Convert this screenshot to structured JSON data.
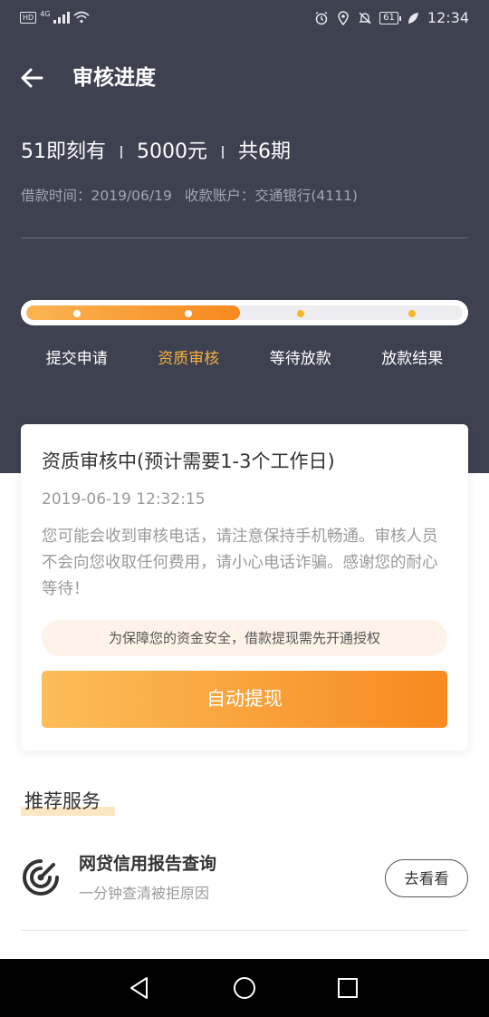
{
  "status_bar": {
    "network": "HD",
    "signal_type": "4G",
    "battery": "61",
    "time": "12:34",
    "icons": [
      "alarm-icon",
      "location-icon",
      "mute-icon",
      "battery-icon",
      "leaf-icon"
    ]
  },
  "header": {
    "title": "审核进度",
    "back_icon": "arrow-left-icon"
  },
  "loan": {
    "product": "51即刻有",
    "amount": "5000元",
    "periods": "共6期",
    "borrow_time": "借款时间：2019/06/19",
    "account": "收款账户：交通银行(4111)"
  },
  "progress": {
    "current_step_index": 1,
    "fill_fraction": 0.49,
    "steps": [
      {
        "label": "提交申请"
      },
      {
        "label": "资质审核"
      },
      {
        "label": "等待放款"
      },
      {
        "label": "放款结果"
      }
    ],
    "colors": {
      "active_text": "#f8b23e",
      "fill_start": "#fbb452",
      "fill_end": "#f7891f",
      "pending_dot": "#f7b52b"
    }
  },
  "status_card": {
    "title": "资质审核中(预计需要1-3个工作日)",
    "time": "2019-06-19 12:32:15",
    "description": "您可能会收到审核电话，请注意保持手机畅通。审核人员不会向您收取任何费用，请小心电话诈骗。感谢您的耐心等待！",
    "notice": "为保障您的资金安全，借款提现需先开通授权",
    "button_label": "自动提现"
  },
  "recommend": {
    "section_title": "推荐服务",
    "items": [
      {
        "icon": "radar-icon",
        "name": "网贷信用报告查询",
        "subtitle": "一分钟查清被拒原因",
        "button_label": "去看看"
      }
    ]
  },
  "nav_bar": {
    "buttons": [
      "back-triangle-icon",
      "home-circle-icon",
      "recents-square-icon"
    ]
  },
  "theme": {
    "header_bg": "#3d4150",
    "accent": "#f7891f"
  }
}
